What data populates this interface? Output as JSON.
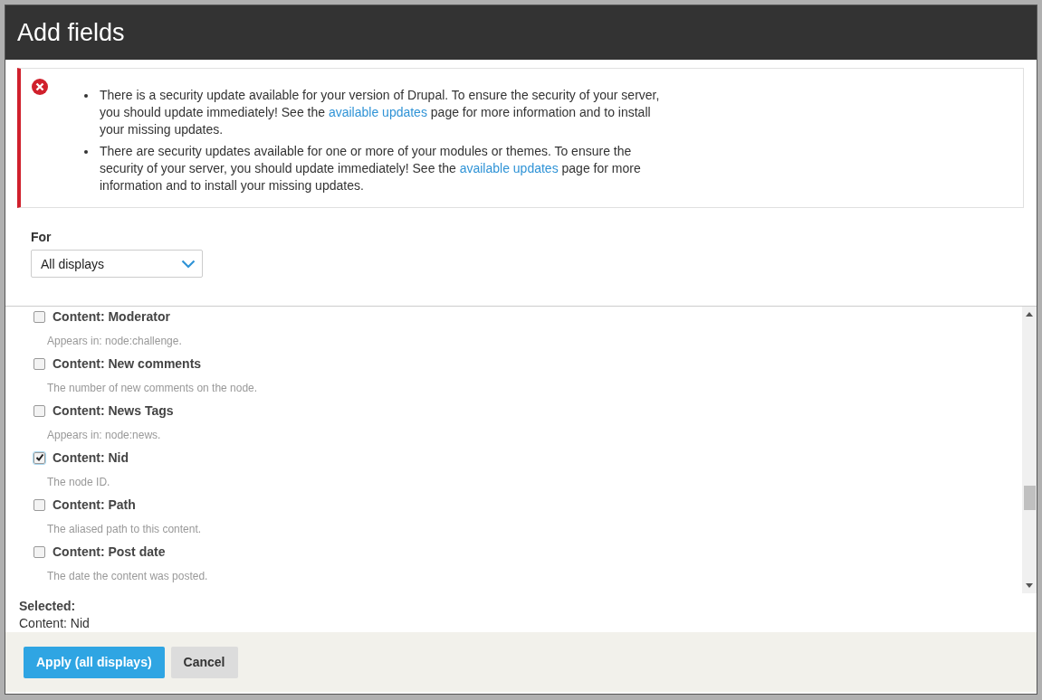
{
  "dialog": {
    "title": "Add fields"
  },
  "messages": [
    {
      "parts": [
        {
          "text": "There is a security update available for your version of Drupal. To ensure the security of your server, you should update immediately! See the ",
          "kind": "text"
        },
        {
          "text": "available updates",
          "kind": "link"
        },
        {
          "text": " page for more information and to install your missing updates.",
          "kind": "text"
        }
      ]
    },
    {
      "parts": [
        {
          "text": "There are security updates available for one or more of your modules or themes. To ensure the security of your server, you should update immediately! See the ",
          "kind": "text"
        },
        {
          "text": "available updates",
          "kind": "link"
        },
        {
          "text": " page for more information and to install your missing updates.",
          "kind": "text"
        }
      ]
    }
  ],
  "for_select": {
    "label": "For",
    "value": "All displays"
  },
  "fields": [
    {
      "label": "Content: Moderator",
      "description": "Appears in: node:challenge.",
      "checked": false
    },
    {
      "label": "Content: New comments",
      "description": "The number of new comments on the node.",
      "checked": false
    },
    {
      "label": "Content: News Tags",
      "description": "Appears in: node:news.",
      "checked": false
    },
    {
      "label": "Content: Nid",
      "description": "The node ID.",
      "checked": true
    },
    {
      "label": "Content: Path",
      "description": "The aliased path to this content.",
      "checked": false
    },
    {
      "label": "Content: Post date",
      "description": "The date the content was posted.",
      "checked": false
    }
  ],
  "selected": {
    "heading": "Selected:",
    "items": [
      "Content: Nid"
    ]
  },
  "buttons": [
    {
      "label": "Apply (all displays)",
      "kind": "primary"
    },
    {
      "label": "Cancel",
      "kind": "secondary"
    }
  ]
}
